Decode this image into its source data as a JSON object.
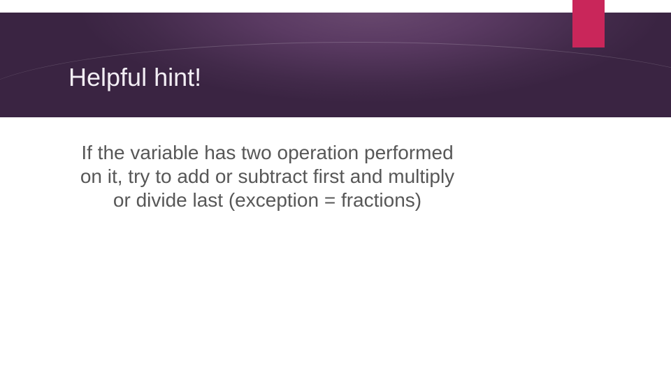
{
  "slide": {
    "title": "Helpful hint!",
    "body": "If the variable has two operation performed on it, try to add or subtract first and multiply or divide last (exception = fractions)"
  },
  "colors": {
    "accent": "#c9265a",
    "header_bg": "#4a2f53",
    "text": "#575757",
    "title_text": "#f2eef4"
  }
}
